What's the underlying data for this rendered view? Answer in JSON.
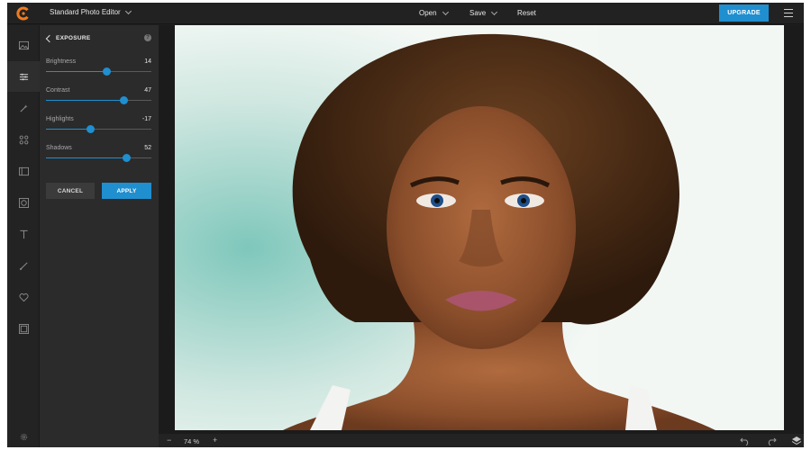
{
  "app": {
    "title": "Standard Photo Editor",
    "accent": "#1f8fd0",
    "logo_color": "#f07b1e"
  },
  "topbar": {
    "menus": [
      {
        "label": "Open"
      },
      {
        "label": "Save"
      },
      {
        "label": "Reset"
      }
    ],
    "upgrade_label": "UPGRADE"
  },
  "rail": {
    "items": [
      {
        "icon": "image-icon"
      },
      {
        "icon": "sliders-icon",
        "active": true
      },
      {
        "icon": "magic-wand-icon"
      },
      {
        "icon": "grid-icon"
      },
      {
        "icon": "frame-icon"
      },
      {
        "icon": "vignette-icon"
      },
      {
        "icon": "text-icon"
      },
      {
        "icon": "brush-icon"
      },
      {
        "icon": "heart-icon"
      },
      {
        "icon": "film-icon"
      },
      {
        "icon": "settings-icon"
      }
    ]
  },
  "panel": {
    "title": "EXPOSURE",
    "sliders": [
      {
        "label": "Brightness",
        "value": "14",
        "fraction": 0.57
      },
      {
        "label": "Contrast",
        "value": "47",
        "fraction": 0.735
      },
      {
        "label": "Highlights",
        "value": "-17",
        "fraction": 0.415
      },
      {
        "label": "Shadows",
        "value": "52",
        "fraction": 0.76
      }
    ],
    "cancel_label": "CANCEL",
    "apply_label": "APPLY"
  },
  "bottombar": {
    "zoom": "74 %"
  }
}
